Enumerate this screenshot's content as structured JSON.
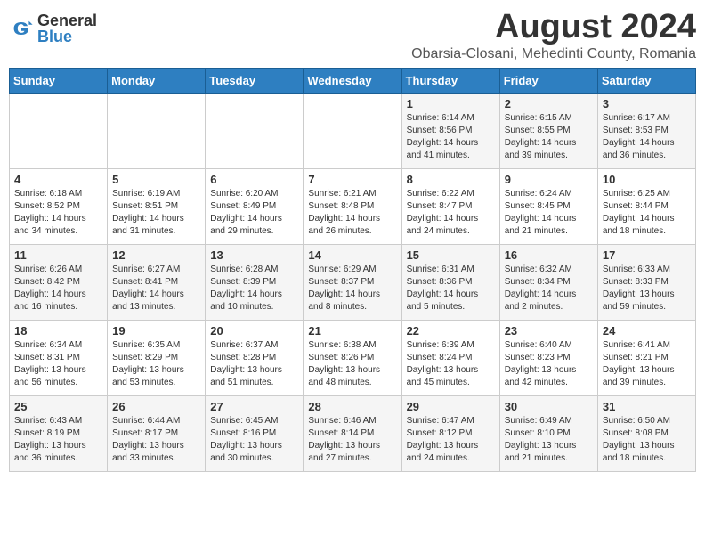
{
  "header": {
    "logo_general": "General",
    "logo_blue": "Blue",
    "month_title": "August 2024",
    "location": "Obarsia-Closani, Mehedinti County, Romania"
  },
  "days_of_week": [
    "Sunday",
    "Monday",
    "Tuesday",
    "Wednesday",
    "Thursday",
    "Friday",
    "Saturday"
  ],
  "weeks": [
    [
      {
        "day": "",
        "info": ""
      },
      {
        "day": "",
        "info": ""
      },
      {
        "day": "",
        "info": ""
      },
      {
        "day": "",
        "info": ""
      },
      {
        "day": "1",
        "info": "Sunrise: 6:14 AM\nSunset: 8:56 PM\nDaylight: 14 hours\nand 41 minutes."
      },
      {
        "day": "2",
        "info": "Sunrise: 6:15 AM\nSunset: 8:55 PM\nDaylight: 14 hours\nand 39 minutes."
      },
      {
        "day": "3",
        "info": "Sunrise: 6:17 AM\nSunset: 8:53 PM\nDaylight: 14 hours\nand 36 minutes."
      }
    ],
    [
      {
        "day": "4",
        "info": "Sunrise: 6:18 AM\nSunset: 8:52 PM\nDaylight: 14 hours\nand 34 minutes."
      },
      {
        "day": "5",
        "info": "Sunrise: 6:19 AM\nSunset: 8:51 PM\nDaylight: 14 hours\nand 31 minutes."
      },
      {
        "day": "6",
        "info": "Sunrise: 6:20 AM\nSunset: 8:49 PM\nDaylight: 14 hours\nand 29 minutes."
      },
      {
        "day": "7",
        "info": "Sunrise: 6:21 AM\nSunset: 8:48 PM\nDaylight: 14 hours\nand 26 minutes."
      },
      {
        "day": "8",
        "info": "Sunrise: 6:22 AM\nSunset: 8:47 PM\nDaylight: 14 hours\nand 24 minutes."
      },
      {
        "day": "9",
        "info": "Sunrise: 6:24 AM\nSunset: 8:45 PM\nDaylight: 14 hours\nand 21 minutes."
      },
      {
        "day": "10",
        "info": "Sunrise: 6:25 AM\nSunset: 8:44 PM\nDaylight: 14 hours\nand 18 minutes."
      }
    ],
    [
      {
        "day": "11",
        "info": "Sunrise: 6:26 AM\nSunset: 8:42 PM\nDaylight: 14 hours\nand 16 minutes."
      },
      {
        "day": "12",
        "info": "Sunrise: 6:27 AM\nSunset: 8:41 PM\nDaylight: 14 hours\nand 13 minutes."
      },
      {
        "day": "13",
        "info": "Sunrise: 6:28 AM\nSunset: 8:39 PM\nDaylight: 14 hours\nand 10 minutes."
      },
      {
        "day": "14",
        "info": "Sunrise: 6:29 AM\nSunset: 8:37 PM\nDaylight: 14 hours\nand 8 minutes."
      },
      {
        "day": "15",
        "info": "Sunrise: 6:31 AM\nSunset: 8:36 PM\nDaylight: 14 hours\nand 5 minutes."
      },
      {
        "day": "16",
        "info": "Sunrise: 6:32 AM\nSunset: 8:34 PM\nDaylight: 14 hours\nand 2 minutes."
      },
      {
        "day": "17",
        "info": "Sunrise: 6:33 AM\nSunset: 8:33 PM\nDaylight: 13 hours\nand 59 minutes."
      }
    ],
    [
      {
        "day": "18",
        "info": "Sunrise: 6:34 AM\nSunset: 8:31 PM\nDaylight: 13 hours\nand 56 minutes."
      },
      {
        "day": "19",
        "info": "Sunrise: 6:35 AM\nSunset: 8:29 PM\nDaylight: 13 hours\nand 53 minutes."
      },
      {
        "day": "20",
        "info": "Sunrise: 6:37 AM\nSunset: 8:28 PM\nDaylight: 13 hours\nand 51 minutes."
      },
      {
        "day": "21",
        "info": "Sunrise: 6:38 AM\nSunset: 8:26 PM\nDaylight: 13 hours\nand 48 minutes."
      },
      {
        "day": "22",
        "info": "Sunrise: 6:39 AM\nSunset: 8:24 PM\nDaylight: 13 hours\nand 45 minutes."
      },
      {
        "day": "23",
        "info": "Sunrise: 6:40 AM\nSunset: 8:23 PM\nDaylight: 13 hours\nand 42 minutes."
      },
      {
        "day": "24",
        "info": "Sunrise: 6:41 AM\nSunset: 8:21 PM\nDaylight: 13 hours\nand 39 minutes."
      }
    ],
    [
      {
        "day": "25",
        "info": "Sunrise: 6:43 AM\nSunset: 8:19 PM\nDaylight: 13 hours\nand 36 minutes."
      },
      {
        "day": "26",
        "info": "Sunrise: 6:44 AM\nSunset: 8:17 PM\nDaylight: 13 hours\nand 33 minutes."
      },
      {
        "day": "27",
        "info": "Sunrise: 6:45 AM\nSunset: 8:16 PM\nDaylight: 13 hours\nand 30 minutes."
      },
      {
        "day": "28",
        "info": "Sunrise: 6:46 AM\nSunset: 8:14 PM\nDaylight: 13 hours\nand 27 minutes."
      },
      {
        "day": "29",
        "info": "Sunrise: 6:47 AM\nSunset: 8:12 PM\nDaylight: 13 hours\nand 24 minutes."
      },
      {
        "day": "30",
        "info": "Sunrise: 6:49 AM\nSunset: 8:10 PM\nDaylight: 13 hours\nand 21 minutes."
      },
      {
        "day": "31",
        "info": "Sunrise: 6:50 AM\nSunset: 8:08 PM\nDaylight: 13 hours\nand 18 minutes."
      }
    ]
  ]
}
